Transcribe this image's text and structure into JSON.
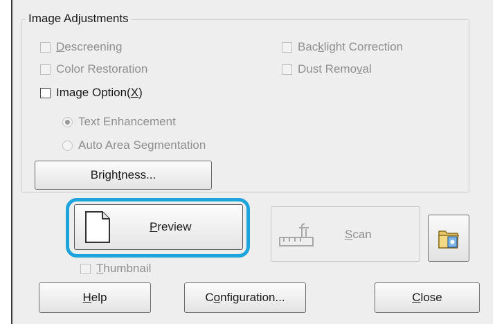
{
  "group": {
    "title": "Image Adjustments"
  },
  "options": {
    "descreening": {
      "pre": "",
      "key": "D",
      "post": "escreening"
    },
    "color_restoration": "Color Restoration",
    "backlight": {
      "pre": "Bac",
      "key": "k",
      "post": "light Correction"
    },
    "dust": {
      "pre": "Dust Remo",
      "key": "v",
      "post": "al"
    },
    "image_option": {
      "pre": "Image Option(",
      "key": "X",
      "post": ")"
    },
    "text_enhancement": "Text Enhancement",
    "auto_area": "Auto Area Segmentation"
  },
  "buttons": {
    "brightness": {
      "pre": "Brigh",
      "key": "t",
      "post": "ness..."
    },
    "preview": {
      "pre": "",
      "key": "P",
      "post": "review"
    },
    "scan": {
      "pre": "",
      "key": "S",
      "post": "can"
    },
    "thumbnail": {
      "pre": "",
      "key": "T",
      "post": "humbnail"
    },
    "help": {
      "pre": "",
      "key": "H",
      "post": "elp"
    },
    "configuration": {
      "pre": "C",
      "key": "o",
      "post": "nfiguration..."
    },
    "close": {
      "pre": "",
      "key": "C",
      "post": "lose"
    }
  },
  "icons": {
    "preview": "document-icon",
    "scan": "scanner-icon",
    "folder": "folder-icon"
  },
  "colors": {
    "highlight": "#1ea4dc"
  }
}
